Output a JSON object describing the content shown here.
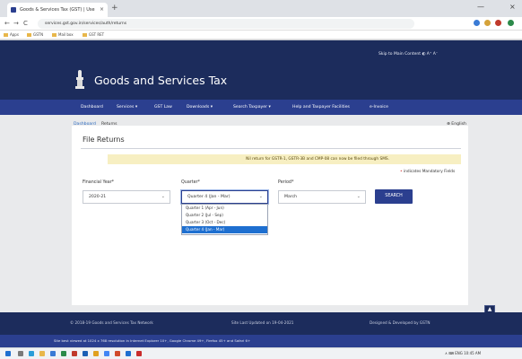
{
  "browser": {
    "tab_title": "Goods & Services Tax (GST) | Use",
    "tab_close": "×",
    "new_tab": "+",
    "minimize": "—",
    "close": "×",
    "back": "←",
    "forward": "→",
    "reload": "C",
    "url": "services.gst.gov.in/services/auth/returns",
    "bookmarks": [
      "Apps",
      "GSTN",
      "Mail box",
      "GST RET"
    ],
    "colors": {
      "tabbar": "#dee1e6",
      "address_bg": "#f1f3f4"
    }
  },
  "header": {
    "top_links": "Skip to Main Content  ◐  A⁺  A⁻",
    "site_title": "Goods and Services Tax",
    "emblem_icon": "national-emblem-icon",
    "colors": {
      "header_bg": "#1c2c5c",
      "menu_bg": "#2b3f8f"
    }
  },
  "menu": {
    "items": [
      "Dashboard",
      "Services ▾",
      "GST Law",
      "Downloads ▾",
      "Search Taxpayer ▾",
      "Help and Taxpayer Facilities",
      "e-Invoice"
    ]
  },
  "breadcrumb": {
    "home": "Dashboard",
    "current": "Returns"
  },
  "language": "⊕ English",
  "page": {
    "title": "File Returns",
    "notice": "Nil return for GSTR-1, GSTR-3B and CMP-08 can now be filed through SMS.",
    "mandatory_star": "•",
    "mandatory_text": "indicates Mandatory Fields"
  },
  "form": {
    "financial_year": {
      "label": "Financial Year*",
      "value": "2020-21"
    },
    "quarter": {
      "label": "Quarter*",
      "value": "Quarter 4 (Jan - Mar)",
      "options": [
        "Quarter 1 (Apr - Jun)",
        "Quarter 2 (Jul - Sep)",
        "Quarter 3 (Oct - Dec)",
        "Quarter 4 (Jan - Mar)"
      ],
      "selected_index": 3
    },
    "period": {
      "label": "Period*",
      "value": "March"
    },
    "search_label": "SEARCH"
  },
  "footer": {
    "copyright": "© 2018-19 Goods and Services Tax Network",
    "updated": "Site Last Updated on 19-04-2021",
    "designed": "Designed & Developed by GSTN",
    "browser_note": "Site best viewed at 1024 x 768 resolution in Internet Explorer 10+, Google Chrome 49+, Firefox 45+ and Safari 6+",
    "scroll_top": "▲"
  },
  "taskbar": {
    "tray": "∧ ⌨ ENG 10:45 AM"
  }
}
